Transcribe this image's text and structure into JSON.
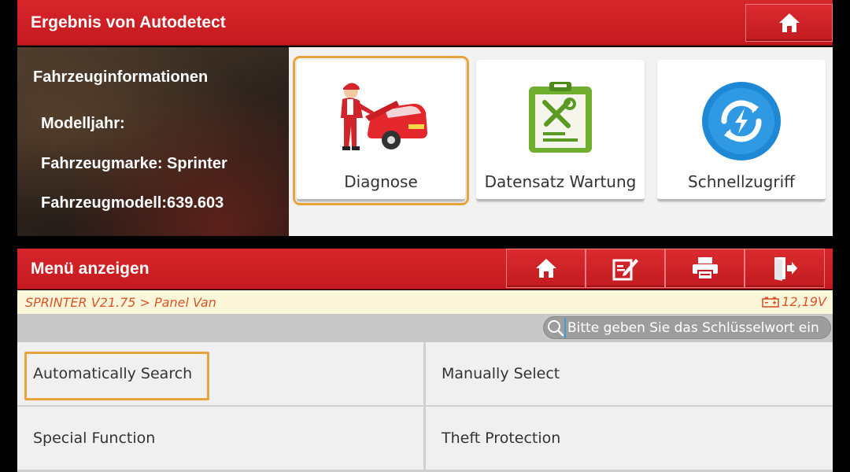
{
  "top": {
    "title": "Ergebnis von Autodetect",
    "home_icon": "home-icon"
  },
  "vehicle_info": {
    "title": "Fahrzeuginformationen",
    "lines": [
      "Modelljahr:",
      "Fahrzeugmarke: Sprinter",
      "Fahrzeugmodell:639.603"
    ]
  },
  "tiles": [
    {
      "label": "Diagnose",
      "icon": "mechanic-car-icon",
      "selected": true
    },
    {
      "label": "Datensatz Wartung",
      "icon": "clipboard-tools-icon",
      "selected": false
    },
    {
      "label": "Schnellzugriff",
      "icon": "quick-access-icon",
      "selected": false
    }
  ],
  "menu": {
    "title": "Menü anzeigen",
    "buttons": [
      "home-icon",
      "edit-icon",
      "print-icon",
      "exit-icon"
    ],
    "breadcrumb": "SPRINTER V21.75 > Panel Van",
    "voltage": "12,19V",
    "search_placeholder": "Bitte geben Sie das Schlüsselwort ein",
    "items": [
      {
        "label": "Automatically Search",
        "selected": true
      },
      {
        "label": "Manually Select",
        "selected": false
      },
      {
        "label": "Special Function",
        "selected": false
      },
      {
        "label": "Theft Protection",
        "selected": false
      }
    ]
  },
  "colors": {
    "header_red": "#c41a1f",
    "highlight_orange": "#e8a33a",
    "breadcrumb_text": "#d9542a"
  }
}
